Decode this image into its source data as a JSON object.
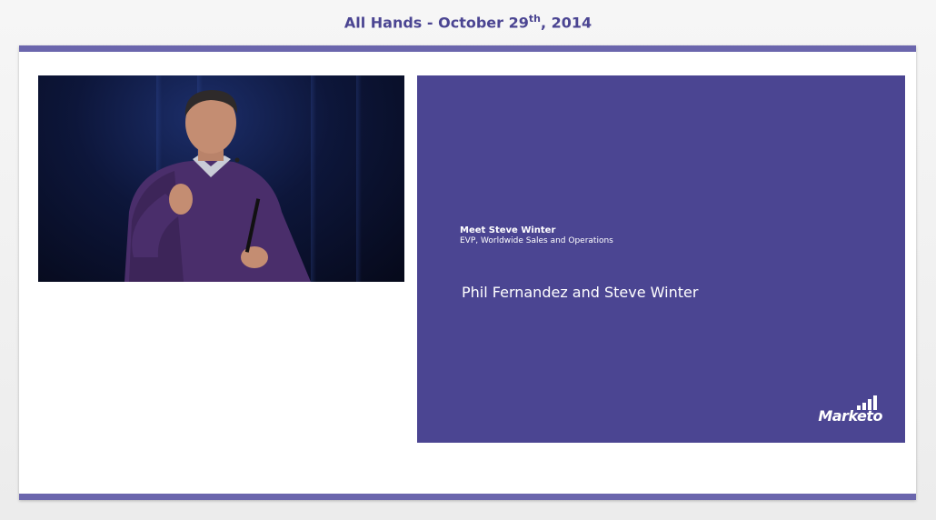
{
  "header": {
    "title_prefix": "All Hands - October 29",
    "title_superscript": "th",
    "title_suffix": ", 2014"
  },
  "slide": {
    "meet_title": "Meet Steve Winter",
    "meet_subtitle": "EVP, Worldwide Sales and Operations",
    "main_text": "Phil Fernandez and Steve Winter",
    "logo_text": "Marketo",
    "background_color": "#4b4592"
  },
  "colors": {
    "accent": "#6b66ad",
    "title": "#4b4592",
    "sweater": "#4a2e6b"
  }
}
